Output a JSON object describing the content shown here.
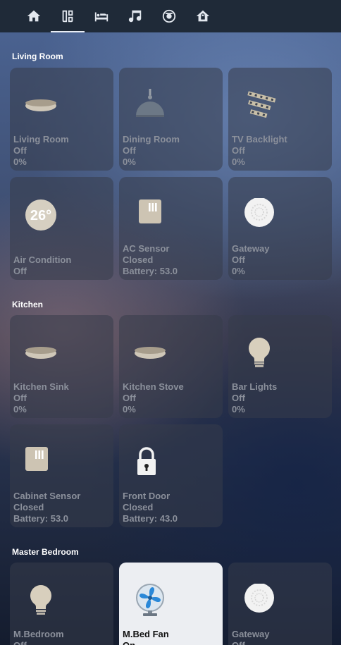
{
  "nav": {
    "tabs": [
      {
        "icon": "home-icon"
      },
      {
        "icon": "dashboard-icon",
        "active": true
      },
      {
        "icon": "bed-icon"
      },
      {
        "icon": "music-icon"
      },
      {
        "icon": "robot-vacuum-icon"
      },
      {
        "icon": "house-lock-icon"
      }
    ]
  },
  "sections": [
    {
      "title": "Living Room",
      "tiles": [
        {
          "name": "Living Room",
          "state": "Off",
          "extra": "0%",
          "icon": "ceiling-light-icon"
        },
        {
          "name": "Dining Room",
          "state": "Off",
          "extra": "0%",
          "icon": "pendant-lamp-icon"
        },
        {
          "name": "TV Backlight",
          "state": "Off",
          "extra": "0%",
          "icon": "led-strip-icon"
        },
        {
          "name": "Air Condition",
          "state": "Off",
          "icon": "thermostat-icon",
          "temperature": "26°"
        },
        {
          "name": "AC Sensor",
          "state": "Closed",
          "extra": "Battery: 53.0",
          "icon": "door-sensor-icon"
        },
        {
          "name": "Gateway",
          "state": "Off",
          "extra": "0%",
          "icon": "gateway-icon"
        }
      ]
    },
    {
      "title": "Kitchen",
      "tiles": [
        {
          "name": "Kitchen Sink",
          "state": "Off",
          "extra": "0%",
          "icon": "ceiling-light-icon"
        },
        {
          "name": "Kitchen Stove",
          "state": "Off",
          "extra": "0%",
          "icon": "ceiling-light-icon"
        },
        {
          "name": "Bar Lights",
          "state": "Off",
          "extra": "0%",
          "icon": "bulb-icon"
        },
        {
          "name": "Cabinet Sensor",
          "state": "Closed",
          "extra": "Battery: 53.0",
          "icon": "door-sensor-icon"
        },
        {
          "name": "Front Door",
          "state": "Closed",
          "extra": "Battery: 43.0",
          "icon": "padlock-icon"
        }
      ]
    },
    {
      "title": "Master Bedroom",
      "tiles": [
        {
          "name": "M.Bedroom",
          "state": "Off",
          "icon": "bulb-icon"
        },
        {
          "name": "M.Bed Fan",
          "state": "On",
          "icon": "fan-icon"
        },
        {
          "name": "Gateway",
          "state": "Off",
          "icon": "gateway-icon"
        }
      ]
    }
  ],
  "colors": {
    "accent": "#2a88d8",
    "tile_on": "#eceef2",
    "muted_text": "#8b909b"
  }
}
